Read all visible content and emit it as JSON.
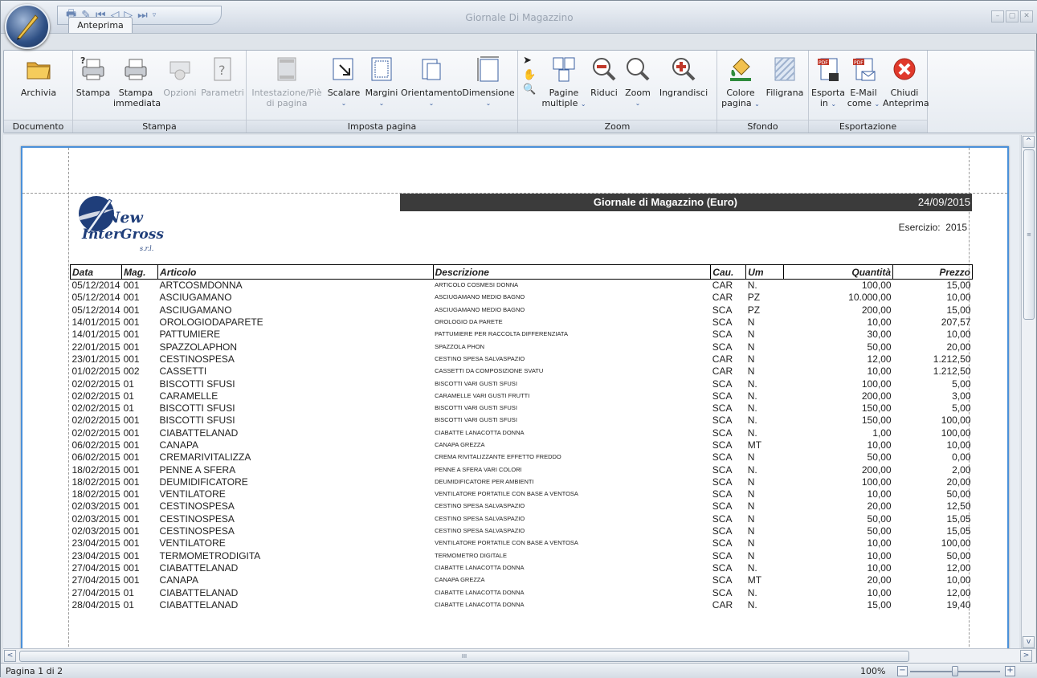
{
  "window": {
    "title": "Giornale Di Magazzino"
  },
  "tabs": [
    {
      "label": "Anteprima"
    }
  ],
  "ribbon": {
    "groups": {
      "documento": "Documento",
      "stampa": "Stampa",
      "imposta": "Imposta pagina",
      "zoom": "Zoom",
      "sfondo": "Sfondo",
      "esportazione": "Esportazione"
    },
    "buttons": {
      "archivia": "Archivia",
      "stampa": "Stampa",
      "stampa_immediata_1": "Stampa",
      "stampa_immediata_2": "immediata",
      "opzioni": "Opzioni",
      "parametri": "Parametri",
      "intestazione_1": "Intestazione/Piè",
      "intestazione_2": "di pagina",
      "scalare": "Scalare",
      "margini": "Margini",
      "orientamento": "Orientamento",
      "dimensione": "Dimensione",
      "pagine_1": "Pagine",
      "pagine_2": "multiple",
      "riduci": "Riduci",
      "zoom": "Zoom",
      "ingrandisci": "Ingrandisci",
      "colore_1": "Colore",
      "colore_2": "pagina",
      "filigrana": "Filigrana",
      "esporta_1": "Esporta",
      "esporta_2": "in",
      "email_1": "E-Mail",
      "email_2": "come",
      "chiudi_1": "Chiudi",
      "chiudi_2": "Anteprima"
    }
  },
  "report": {
    "title": "Giornale di Magazzino (Euro)",
    "date": "24/09/2015",
    "esercizio_label": "Esercizio:",
    "esercizio_value": "2015",
    "logo_text_1": "New",
    "logo_text_2": "InterGross",
    "logo_text_3": "s.r.l.",
    "columns": [
      "Data",
      "Mag.",
      "Articolo",
      "Descrizione",
      "Cau.",
      "Um",
      "Quantità",
      "Prezzo"
    ],
    "rows": [
      [
        "05/12/2014",
        "001",
        "ARTCOSMDONNA",
        "ARTICOLO COSMESI DONNA",
        "CAR",
        "N.",
        "100,00",
        "15,00"
      ],
      [
        "05/12/2014",
        "001",
        "ASCIUGAMANO",
        "ASCIUGAMANO MEDIO BAGNO",
        "CAR",
        "PZ",
        "10.000,00",
        "10,00"
      ],
      [
        "05/12/2014",
        "001",
        "ASCIUGAMANO",
        "ASCIUGAMANO MEDIO BAGNO",
        "SCA",
        "PZ",
        "200,00",
        "15,00"
      ],
      [
        "14/01/2015",
        "001",
        "OROLOGIODAPARETE",
        "OROLOGIO DA PARETE",
        "SCA",
        "N",
        "10,00",
        "207,57"
      ],
      [
        "14/01/2015",
        "001",
        "PATTUMIERE",
        "PATTUMIERE PER RACCOLTA DIFFERENZIATA",
        "SCA",
        "N",
        "30,00",
        "10,00"
      ],
      [
        "22/01/2015",
        "001",
        "SPAZZOLAPHON",
        "SPAZZOLA PHON",
        "SCA",
        "N",
        "50,00",
        "20,00"
      ],
      [
        "23/01/2015",
        "001",
        "CESTINOSPESA",
        "CESTINO SPESA SALVASPAZIO",
        "CAR",
        "N",
        "12,00",
        "1.212,50"
      ],
      [
        "01/02/2015",
        "002",
        "CASSETTI",
        "CASSETTI DA COMPOSIZIONE SVATU",
        "CAR",
        "N",
        "10,00",
        "1.212,50"
      ],
      [
        "02/02/2015",
        "01",
        "BISCOTTI SFUSI",
        "BISCOTTI VARI GUSTI SFUSI",
        "SCA",
        "N.",
        "100,00",
        "5,00"
      ],
      [
        "02/02/2015",
        "01",
        "CARAMELLE",
        "CARAMELLE VARI GUSTI FRUTTI",
        "SCA",
        "N.",
        "200,00",
        "3,00"
      ],
      [
        "02/02/2015",
        "01",
        "BISCOTTI SFUSI",
        "BISCOTTI VARI GUSTI SFUSI",
        "SCA",
        "N.",
        "150,00",
        "5,00"
      ],
      [
        "02/02/2015",
        "001",
        "BISCOTTI SFUSI",
        "BISCOTTI VARI GUSTI SFUSI",
        "SCA",
        "N.",
        "150,00",
        "100,00"
      ],
      [
        "02/02/2015",
        "001",
        "CIABATTELANAD",
        "CIABATTE LANACOTTA DONNA",
        "SCA",
        "N.",
        "1,00",
        "100,00"
      ],
      [
        "06/02/2015",
        "001",
        "CANAPA",
        "CANAPA GREZZA",
        "SCA",
        "MT",
        "10,00",
        "10,00"
      ],
      [
        "06/02/2015",
        "001",
        "CREMARIVITALIZZA",
        "CREMA RIVITALIZZANTE EFFETTO FREDDO",
        "SCA",
        "N",
        "50,00",
        "0,00"
      ],
      [
        "18/02/2015",
        "001",
        "PENNE A SFERA",
        "PENNE A SFERA VARI COLORI",
        "SCA",
        "N.",
        "200,00",
        "2,00"
      ],
      [
        "18/02/2015",
        "001",
        "DEUMIDIFICATORE",
        "DEUMIDIFICATORE PER AMBIENTI",
        "SCA",
        "N",
        "100,00",
        "20,00"
      ],
      [
        "18/02/2015",
        "001",
        "VENTILATORE",
        "VENTILATORE PORTATILE CON BASE A VENTOSA",
        "SCA",
        "N",
        "10,00",
        "50,00"
      ],
      [
        "02/03/2015",
        "001",
        "CESTINOSPESA",
        "CESTINO SPESA SALVASPAZIO",
        "SCA",
        "N",
        "20,00",
        "12,50"
      ],
      [
        "02/03/2015",
        "001",
        "CESTINOSPESA",
        "CESTINO SPESA SALVASPAZIO",
        "SCA",
        "N",
        "50,00",
        "15,05"
      ],
      [
        "02/03/2015",
        "001",
        "CESTINOSPESA",
        "CESTINO SPESA SALVASPAZIO",
        "SCA",
        "N",
        "50,00",
        "15,05"
      ],
      [
        "23/04/2015",
        "001",
        "VENTILATORE",
        "VENTILATORE PORTATILE CON BASE A VENTOSA",
        "SCA",
        "N",
        "10,00",
        "100,00"
      ],
      [
        "23/04/2015",
        "001",
        "TERMOMETRODIGITA",
        "TERMOMETRO DIGITALE",
        "SCA",
        "N",
        "10,00",
        "50,00"
      ],
      [
        "27/04/2015",
        "001",
        "CIABATTELANAD",
        "CIABATTE LANACOTTA DONNA",
        "SCA",
        "N.",
        "10,00",
        "12,00"
      ],
      [
        "27/04/2015",
        "001",
        "CANAPA",
        "CANAPA GREZZA",
        "SCA",
        "MT",
        "20,00",
        "10,00"
      ],
      [
        "27/04/2015",
        "01",
        "CIABATTELANAD",
        "CIABATTE LANACOTTA DONNA",
        "SCA",
        "N.",
        "10,00",
        "12,00"
      ],
      [
        "28/04/2015",
        "01",
        "CIABATTELANAD",
        "CIABATTE LANACOTTA DONNA",
        "CAR",
        "N.",
        "15,00",
        "19,40"
      ]
    ]
  },
  "status": {
    "page_info": "Pagina 1 di 2",
    "zoom": "100%",
    "zoom_minus": "−",
    "zoom_plus": "+"
  },
  "scroll": {
    "grip": "≡",
    "hgrip": "III",
    "up": "^",
    "down": "v",
    "left": "<",
    "right": ">"
  }
}
